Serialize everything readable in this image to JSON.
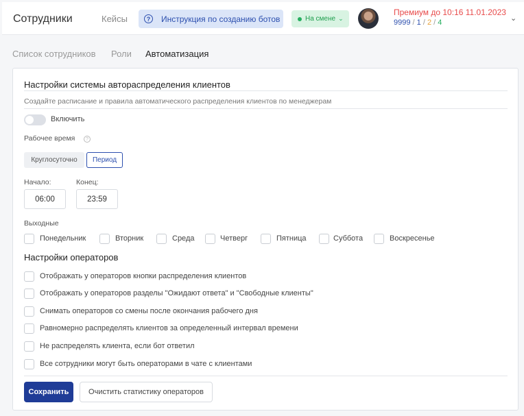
{
  "header": {
    "title": "Сотрудники",
    "cases": "Кейсы",
    "instruction": "Инструкция по созданию ботов",
    "status": "На смене",
    "premium": "Премиум до 10:16 11.01.2023",
    "counts": {
      "total": "9999",
      "sep": " / ",
      "a": "1",
      "b": "2",
      "c": "4"
    },
    "colors": {
      "accent": "#2c4fae",
      "status_green": "#27ae60",
      "premium_red": "#e84a4a"
    }
  },
  "tabs": [
    {
      "label": "Список сотрудников",
      "active": false
    },
    {
      "label": "Роли",
      "active": false
    },
    {
      "label": "Автоматизация",
      "active": true
    }
  ],
  "settings": {
    "title": "Настройки системы автораспределения клиентов",
    "description": "Создайте расписание и правила автоматического распределения клиентов по менеджерам",
    "enable_label": "Включить",
    "work_time_label": "Рабочее время",
    "mode_options": [
      "Круглосуточно",
      "Период"
    ],
    "mode_selected": "Период",
    "start_label": "Начало:",
    "start_value": "06:00",
    "end_label": "Конец:",
    "end_value": "23:59",
    "weekends_label": "Выходные",
    "days": [
      "Понедельник",
      "Вторник",
      "Среда",
      "Четверг",
      "Пятница",
      "Суббота",
      "Воскресенье"
    ]
  },
  "operators": {
    "title": "Настройки операторов",
    "options": [
      "Отображать у операторов кнопки распределения клиентов",
      "Отображать у операторов разделы \"Ожидают ответа\" и \"Свободные клиенты\"",
      "Снимать операторов со смены после окончания рабочего дня",
      "Равномерно распределять клиентов за определенный интервал времени",
      "Не распределять клиента, если бот ответил",
      "Все сотрудники могут быть операторами в чате с клиентами"
    ]
  },
  "actions": {
    "save": "Сохранить",
    "clear_stats": "Очистить статистику операторов"
  }
}
